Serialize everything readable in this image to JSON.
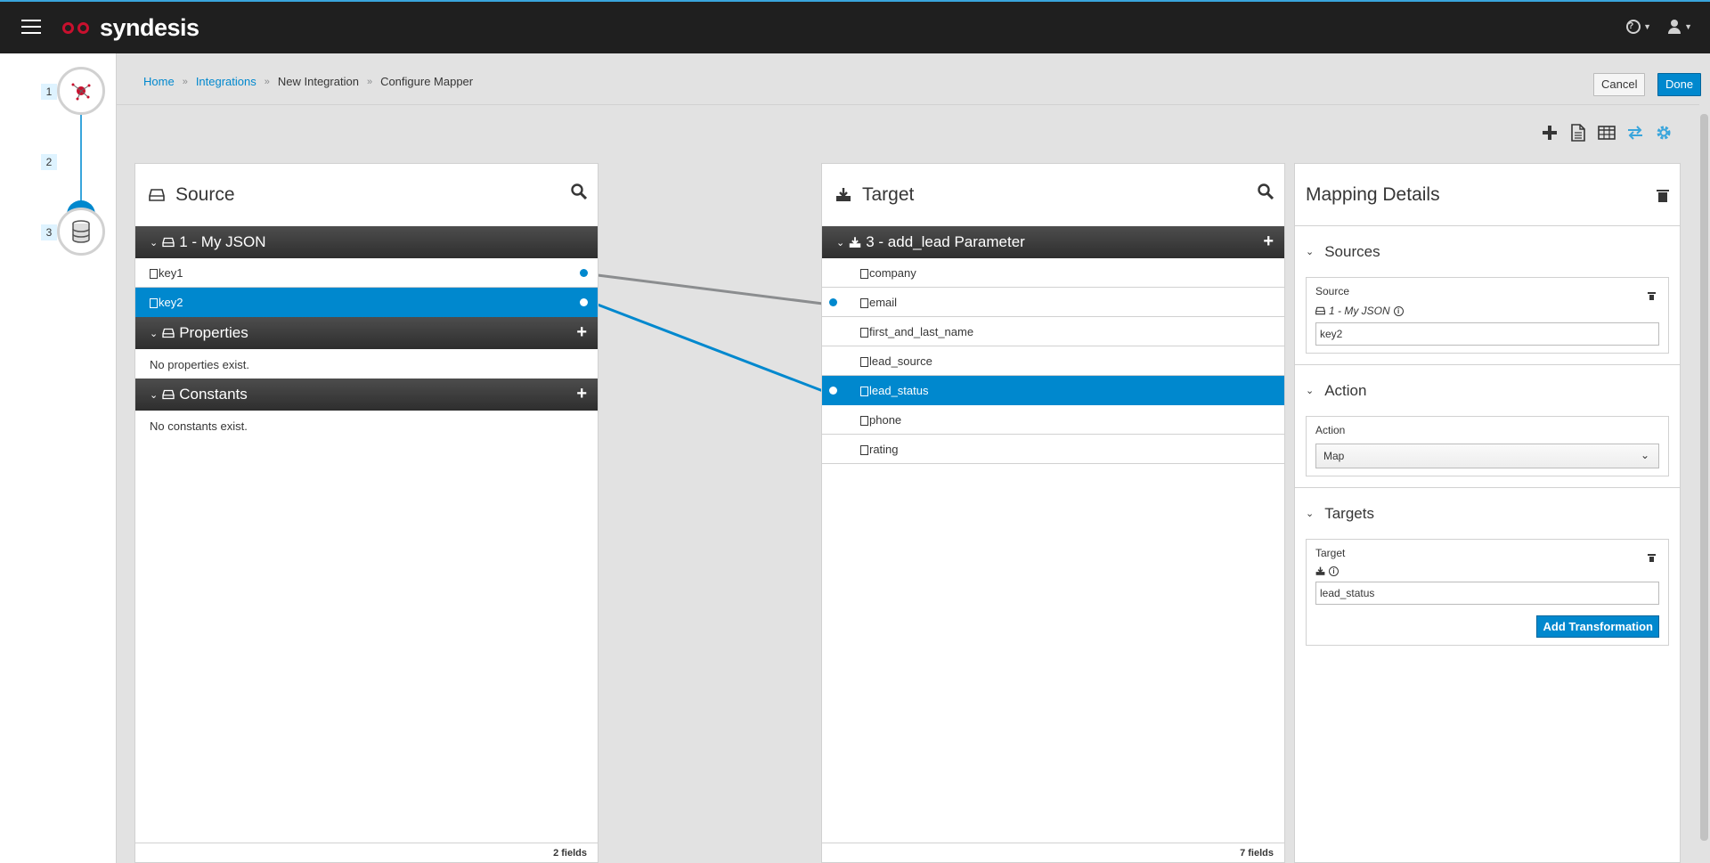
{
  "app": {
    "name": "syndesis"
  },
  "colors": {
    "accent": "#0088ce",
    "topbar": "#1f1f1f",
    "logo_eyes": "#c8102e"
  },
  "steps": [
    {
      "number": "1",
      "icon": "connection-icon"
    },
    {
      "number": "2",
      "icon": "active-step-icon"
    },
    {
      "number": "3",
      "icon": "database-icon"
    }
  ],
  "breadcrumb": {
    "home": "Home",
    "integrations": "Integrations",
    "new_integration": "New Integration",
    "current": "Configure Mapper"
  },
  "header": {
    "cancel_label": "Cancel",
    "done_label": "Done"
  },
  "toolbar": [
    "add-icon",
    "document-icon",
    "table-icon",
    "arrows-icon",
    "gear-icon"
  ],
  "source": {
    "title": "Source",
    "group": "1 - My JSON",
    "fields": [
      "key1",
      "key2"
    ],
    "properties_title": "Properties",
    "properties_empty": "No properties exist.",
    "constants_title": "Constants",
    "constants_empty": "No constants exist.",
    "footer": "2 fields"
  },
  "target": {
    "title": "Target",
    "group": "3 - add_lead Parameter",
    "fields": [
      "company",
      "email",
      "first_and_last_name",
      "lead_source",
      "lead_status",
      "phone",
      "rating"
    ],
    "footer": "7 fields"
  },
  "mapping": {
    "title": "Mapping Details",
    "sources_title": "Sources",
    "source_label": "Source",
    "source_doc": "1 - My JSON",
    "source_value": "key2",
    "action_title": "Action",
    "action_label": "Action",
    "action_value": "Map",
    "targets_title": "Targets",
    "target_label": "Target",
    "target_value": "lead_status",
    "add_transformation": "Add Transformation"
  }
}
